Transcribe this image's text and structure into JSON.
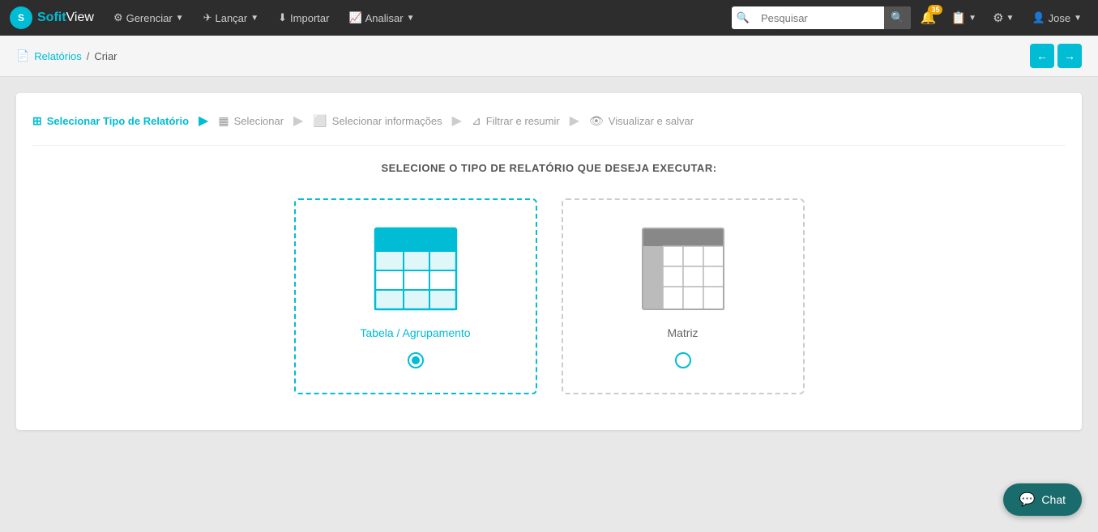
{
  "brand": {
    "logo_text": "S",
    "name_part1": "Sofit",
    "name_part2": "View"
  },
  "navbar": {
    "items": [
      {
        "label": "Gerenciar",
        "has_dropdown": true
      },
      {
        "label": "Lançar",
        "has_dropdown": true
      },
      {
        "label": "Importar",
        "has_dropdown": false
      },
      {
        "label": "Analisar",
        "has_dropdown": true
      }
    ],
    "search_placeholder": "Pesquisar",
    "notification_count": "35",
    "user_label": "Jose"
  },
  "breadcrumb": {
    "parent_label": "Relatórios",
    "separator": "/",
    "current_label": "Criar"
  },
  "wizard": {
    "steps": [
      {
        "label": "Selecionar Tipo de Relatório",
        "icon": "grid",
        "active": true
      },
      {
        "label": "Selecionar",
        "icon": "table",
        "active": false
      },
      {
        "label": "Selecionar informações",
        "icon": "columns",
        "active": false
      },
      {
        "label": "Filtrar e resumir",
        "icon": "filter",
        "active": false
      },
      {
        "label": "Visualizar e salvar",
        "icon": "eye",
        "active": false
      }
    ]
  },
  "report_selection": {
    "title": "SELECIONE O TIPO DE RELATÓRIO QUE DESEJA EXECUTAR:",
    "options": [
      {
        "id": "tabela",
        "label": "Tabela / Agrupamento",
        "selected": true
      },
      {
        "id": "matriz",
        "label": "Matriz",
        "selected": false
      }
    ]
  },
  "chat": {
    "label": "Chat"
  }
}
